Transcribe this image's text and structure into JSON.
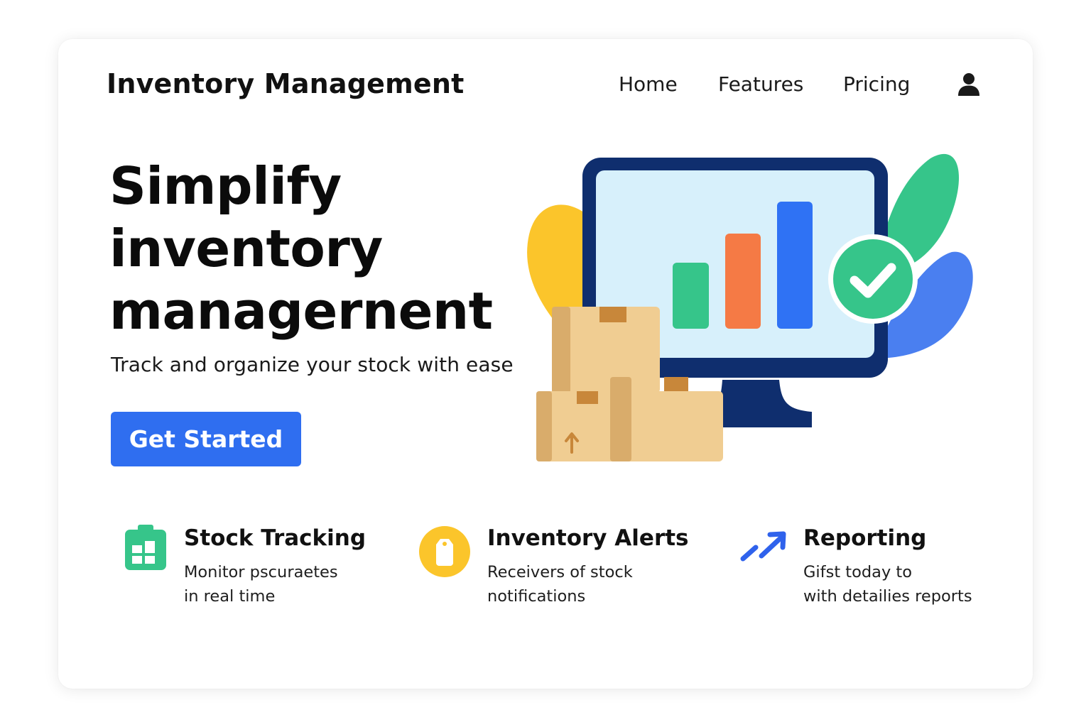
{
  "header": {
    "brand": "Inventory Management",
    "nav": [
      {
        "label": "Home"
      },
      {
        "label": "Features"
      },
      {
        "label": "Pricing"
      }
    ],
    "user_icon": "user-icon"
  },
  "hero": {
    "title_lines": [
      "Simplify",
      "inventory",
      "managernent"
    ],
    "subtitle": "Track and organize your stock with ease",
    "cta_label": "Get Started",
    "illustration": "monitor-with-bar-chart-boxes-and-checkmark"
  },
  "features": [
    {
      "icon": "clipboard-grid-icon",
      "title": "Stock Tracking",
      "desc_lines": [
        "Monitor pscuraetes",
        "in real time"
      ]
    },
    {
      "icon": "tag-alert-icon",
      "title": "Inventory Alerts",
      "desc_lines": [
        "Receivers of stock",
        "notifications"
      ]
    },
    {
      "icon": "trending-arrow-icon",
      "title": "Reporting",
      "desc_lines": [
        "Gifst today to",
        "with detailies reports"
      ]
    }
  ],
  "colors": {
    "primary": "#2f6ef0",
    "green": "#36c58a",
    "orange": "#f57a45",
    "blue": "#2f72f4",
    "yellow": "#fbc52b",
    "navy": "#0f2e6e",
    "screen": "#d7f0fb",
    "box": "#f0cd92"
  }
}
